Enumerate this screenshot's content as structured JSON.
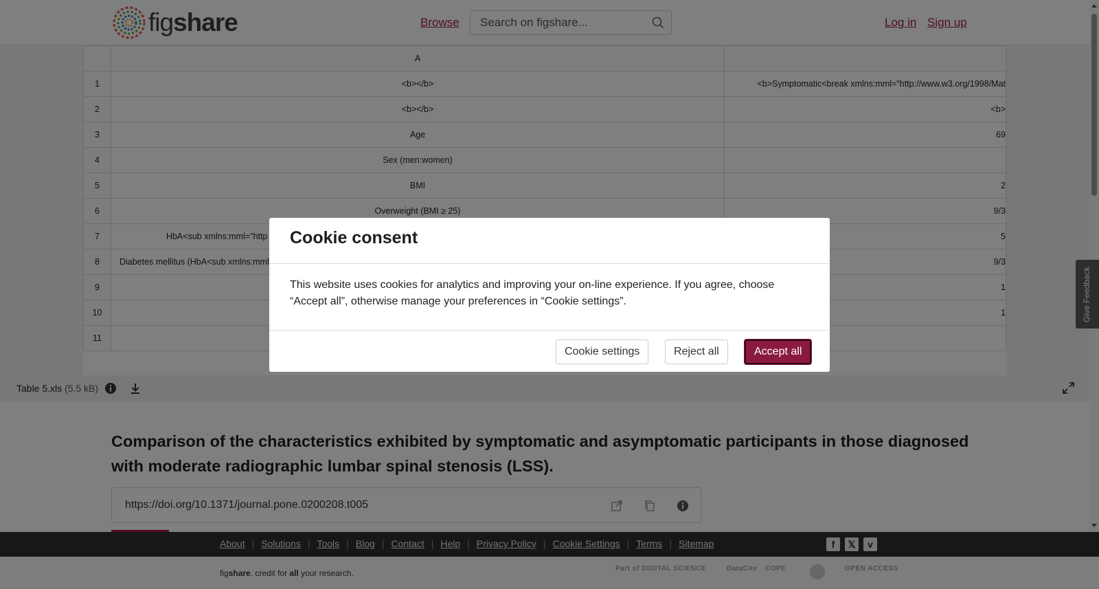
{
  "header": {
    "logo_text_light": "fig",
    "logo_text_bold": "share",
    "browse_label": "Browse",
    "search_placeholder": "Search on figshare...",
    "login_label": "Log in",
    "signup_label": "Sign up"
  },
  "sheet": {
    "col_headers": [
      "",
      "A",
      ""
    ],
    "rows": [
      {
        "num": "1",
        "a": "<b></b>",
        "b": "<b>Symptomatic<break xmlns:mml=\"http://www.w3.org/1998/Mat"
      },
      {
        "num": "2",
        "a": "<b></b>",
        "b": "<b>"
      },
      {
        "num": "3",
        "a": "Age",
        "b": "69"
      },
      {
        "num": "4",
        "a": "Sex (men:women)",
        "b": ""
      },
      {
        "num": "5",
        "a": "BMI",
        "b": "2"
      },
      {
        "num": "6",
        "a": "Overweight (BMI ≥ 25)",
        "b": "9/3"
      },
      {
        "num": "7",
        "a": "HbA<sub xmlns:mml=\"http",
        "b": "5"
      },
      {
        "num": "8",
        "a": "Diabetes mellitus (HbA<sub xmlns:mml",
        "b": "9/3"
      },
      {
        "num": "9",
        "a": "",
        "b": "1"
      },
      {
        "num": "10",
        "a": "",
        "b": "1"
      },
      {
        "num": "11",
        "a": "",
        "b": ""
      }
    ]
  },
  "file": {
    "name": "Table 5.xls",
    "size": "(5.5 kB)"
  },
  "main": {
    "title": "Comparison of the characteristics exhibited by symptomatic and asymptomatic participants in those diagnosed with moderate radiographic lumbar spinal stenosis (LSS).",
    "doi": "https://doi.org/10.1371/journal.pone.0200208.t005"
  },
  "feedback_label": "Give Feedback",
  "footer": {
    "links": [
      "About",
      "Solutions",
      "Tools",
      "Blog",
      "Contact",
      "Help",
      "Privacy Policy",
      "Cookie Settings",
      "Terms",
      "Sitemap"
    ],
    "social": [
      "f",
      "𝕏",
      "v"
    ],
    "tagline_pre": "fig",
    "tagline_bold": "share",
    "tagline_mid": ". credit for ",
    "tagline_all": "all",
    "tagline_end": " your research.",
    "partners": [
      "Part of DIGITAL SCIENCE",
      "DataCite",
      "COPE",
      "",
      "OPEN ACCESS"
    ]
  },
  "modal": {
    "title": "Cookie consent",
    "body": "This website uses cookies for analytics and improving your on-line experience. If you agree, choose “Accept all”, otherwise manage your preferences in “Cookie settings”.",
    "settings_label": "Cookie settings",
    "reject_label": "Reject all",
    "accept_label": "Accept all"
  },
  "colors": {
    "brand": "#9c1d4a",
    "accept_bg": "#8a1a42",
    "footer_bg": "#2e2e2e"
  }
}
